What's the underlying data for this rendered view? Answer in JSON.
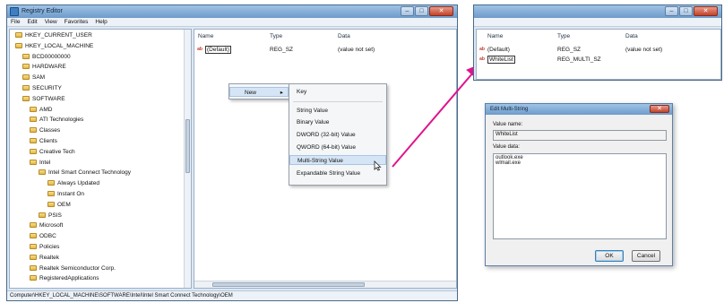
{
  "main_window": {
    "title": "Registry Editor",
    "menu": [
      "File",
      "Edit",
      "View",
      "Favorites",
      "Help"
    ],
    "tree": [
      {
        "label": "HKEY_CURRENT_USER",
        "level": 1
      },
      {
        "label": "HKEY_LOCAL_MACHINE",
        "level": 1
      },
      {
        "label": "BCD00000000",
        "level": 2
      },
      {
        "label": "HARDWARE",
        "level": 2
      },
      {
        "label": "SAM",
        "level": 2
      },
      {
        "label": "SECURITY",
        "level": 2
      },
      {
        "label": "SOFTWARE",
        "level": 2
      },
      {
        "label": "AMD",
        "level": 3
      },
      {
        "label": "ATI Technologies",
        "level": 3
      },
      {
        "label": "Classes",
        "level": 3
      },
      {
        "label": "Clients",
        "level": 3
      },
      {
        "label": "Creative Tech",
        "level": 3
      },
      {
        "label": "Intel",
        "level": 3
      },
      {
        "label": "Intel Smart Connect Technology",
        "level": 4
      },
      {
        "label": "Always Updated",
        "level": 5
      },
      {
        "label": "Instant On",
        "level": 5
      },
      {
        "label": "OEM",
        "level": 5
      },
      {
        "label": "PSIS",
        "level": 4
      },
      {
        "label": "Microsoft",
        "level": 3
      },
      {
        "label": "ODBC",
        "level": 3
      },
      {
        "label": "Policies",
        "level": 3
      },
      {
        "label": "Realtek",
        "level": 3
      },
      {
        "label": "Realtek Semiconductor Corp.",
        "level": 3
      },
      {
        "label": "RegisteredApplications",
        "level": 3
      }
    ],
    "columns": {
      "name": "Name",
      "type": "Type",
      "data": "Data"
    },
    "values": [
      {
        "name": "(Default)",
        "type": "REG_SZ",
        "data": "(value not set)"
      }
    ],
    "statusbar": "Computer\\HKEY_LOCAL_MACHINE\\SOFTWARE\\Intel\\Intel Smart Connect Technology\\OEM"
  },
  "context_menu": {
    "new_label": "New",
    "new_arrow": "▸",
    "items": [
      "Key",
      "String Value",
      "Binary Value",
      "DWORD (32-bit) Value",
      "QWORD (64-bit) Value",
      "Multi-String Value",
      "Expandable String Value"
    ]
  },
  "second_window": {
    "columns": {
      "name": "Name",
      "type": "Type",
      "data": "Data"
    },
    "values": [
      {
        "name": "(Default)",
        "type": "REG_SZ",
        "data": "(value not set)"
      },
      {
        "name": "WhiteList",
        "type": "REG_MULTI_SZ",
        "data": ""
      }
    ]
  },
  "dialog": {
    "title": "Edit Multi-String",
    "value_name_label": "Value name:",
    "value_name": "WhiteList",
    "value_data_label": "Value data:",
    "value_data_lines": [
      "outlook.exe",
      "wlmail.exe"
    ],
    "ok": "OK",
    "cancel": "Cancel"
  },
  "colors": {
    "arrow": "#e0138c"
  },
  "icons": [
    "registry-icon",
    "folder-icon",
    "string-value-icon",
    "submenu-arrow-icon",
    "mouse-cursor-icon"
  ]
}
